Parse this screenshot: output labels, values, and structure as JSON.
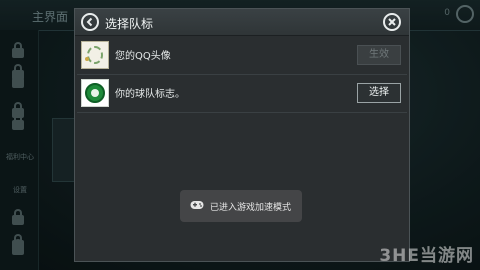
{
  "background": {
    "title": "主界面",
    "side_labels": [
      "福利中心",
      "设置"
    ],
    "badge": "0"
  },
  "dialog": {
    "title": "选择队标",
    "rows": [
      {
        "label": "您的QQ头像",
        "button": "生效",
        "button_state": "disabled"
      },
      {
        "label": "你的球队标志。",
        "button": "选择",
        "button_state": "enabled"
      }
    ]
  },
  "toast": {
    "text": "已进入游戏加速模式",
    "icon": "gamepad-icon"
  },
  "watermark": "3HE当游网",
  "colors": {
    "dialog_bg": "#2a2e30",
    "header_bg": "#3a4144",
    "toast_bg": "#46484a"
  }
}
